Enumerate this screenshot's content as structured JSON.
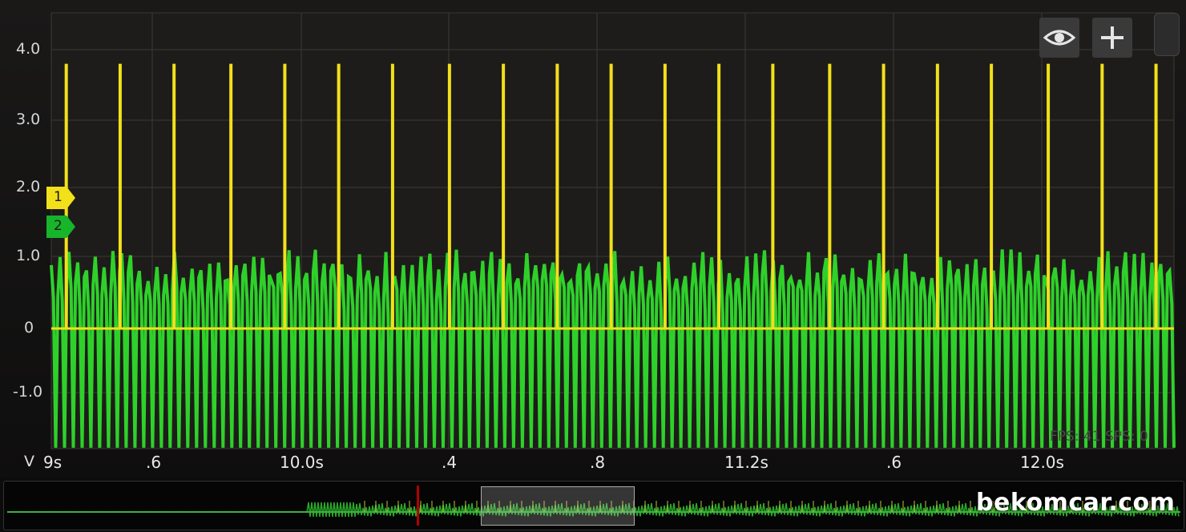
{
  "chart_data": {
    "type": "line",
    "y_unit": "V",
    "ylim": [
      -1.8,
      4.6
    ],
    "yticks": [
      "4.0",
      "3.0",
      "2.0",
      "1.0",
      "0",
      "-1.0"
    ],
    "x_range_s": [
      9.0,
      12.75
    ],
    "xticks": [
      "9s",
      ".6",
      "10.0s",
      ".4",
      ".8",
      "11.2s",
      ".6",
      "12.0s"
    ],
    "grid": true,
    "series": [
      {
        "name": "1",
        "color": "#f2e01a",
        "style": "pulse",
        "baseline": 0.0,
        "peak": 3.8,
        "pulse_times_s": [
          9.05,
          9.23,
          9.41,
          9.6,
          9.78,
          9.96,
          10.14,
          10.33,
          10.51,
          10.69,
          10.87,
          11.05,
          11.23,
          11.41,
          11.6,
          11.78,
          11.96,
          12.14,
          12.33,
          12.51,
          12.69
        ]
      },
      {
        "name": "2",
        "color": "#2ed12a",
        "style": "oscillation",
        "min": -1.8,
        "max": 1.1,
        "frequency_hz": 34
      }
    ]
  },
  "toolbar": {
    "view_icon": "eye-icon",
    "add_icon": "plus-icon"
  },
  "stats": "FPS: 41 SPS: 0",
  "watermark": "bekomcar.com"
}
